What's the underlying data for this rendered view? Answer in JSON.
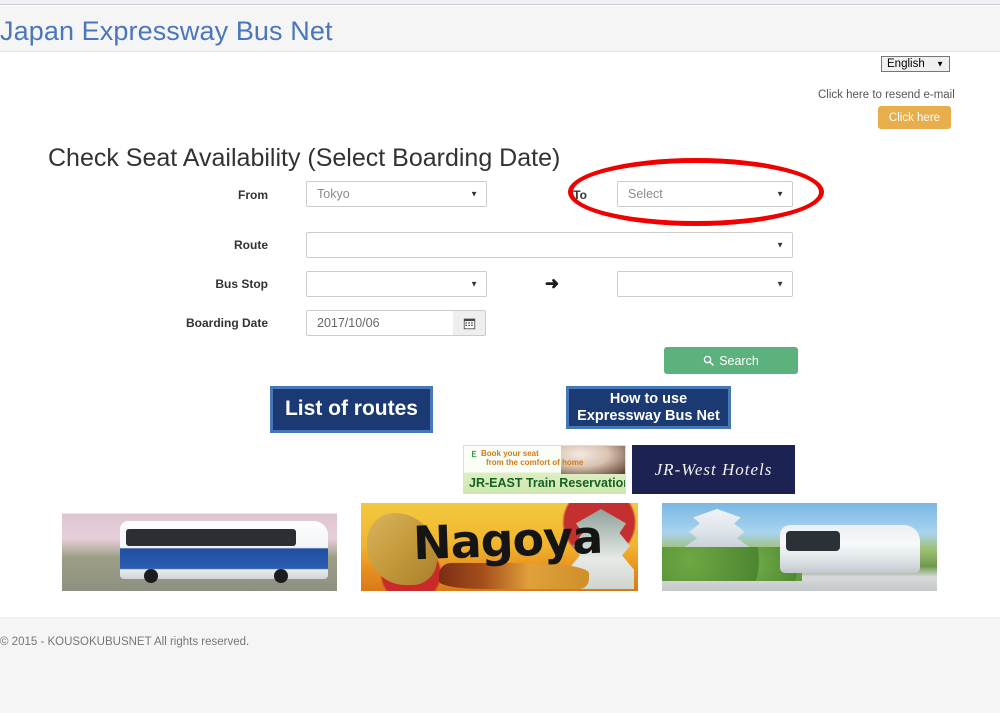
{
  "site": {
    "title": "Japan Expressway Bus Net"
  },
  "topbar": {
    "language": {
      "selected": "English",
      "caret": "▼"
    },
    "resend_text": "Click here to resend e-mail",
    "resend_button": "Click here"
  },
  "main": {
    "heading": "Check Seat Availability (Select Boarding Date)",
    "fields": {
      "from_label": "From",
      "from_value": "Tokyo",
      "to_label": "To",
      "to_value": "Select",
      "route_label": "Route",
      "route_value": "",
      "bus_stop_label": "Bus Stop",
      "bus_stop_from_value": "",
      "bus_stop_to_value": "",
      "boarding_date_label": "Boarding Date",
      "boarding_date_value": "2017/10/06",
      "caret": "▼",
      "arrow": "➜"
    },
    "search_button": "Search"
  },
  "nav_buttons": {
    "list_of_routes": "List of routes",
    "how_to_use_line1": "How to use",
    "how_to_use_line2": "Expressway Bus Net"
  },
  "ads": {
    "jr_east": {
      "logo": "Ｅ",
      "line1": "Book your seat",
      "line2": "from the comfort of home",
      "line3": "JR-EAST Train Reservation"
    },
    "jr_west": {
      "text": "JR-West  Hotels"
    }
  },
  "photos": {
    "photo1_alt": "JR bus with cherry blossoms",
    "photo2_text": "Nagoya",
    "photo3_alt": "Osaka castle with expressway bus"
  },
  "footer": {
    "copyright": "© 2015 - KOUSOKUBUSNET All rights reserved."
  },
  "annotation": {
    "shape": "red-ellipse-highlight",
    "color": "#f00000",
    "target": "to-destination-select"
  },
  "colors": {
    "brand_blue": "#4a76bd",
    "accent_orange": "#e8ae4c",
    "search_green": "#5cb27d",
    "navy": "#1b3a74",
    "navy_border": "#4678b5",
    "annotation_red": "#f00000"
  }
}
